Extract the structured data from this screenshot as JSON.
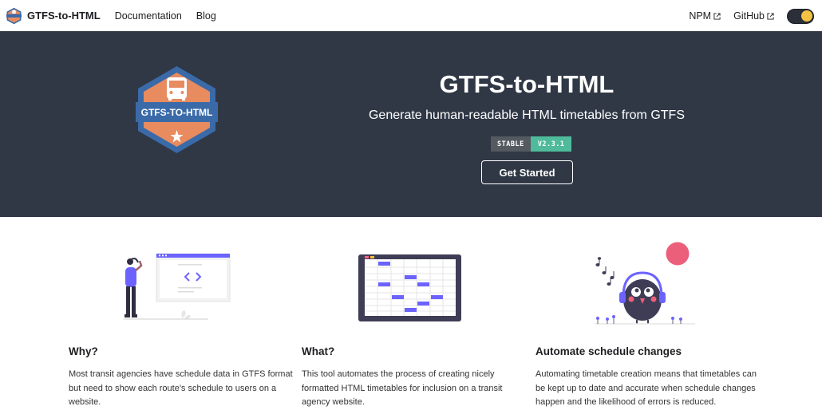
{
  "navbar": {
    "brand_title": "GTFS-to-HTML",
    "links": [
      "Documentation",
      "Blog"
    ],
    "right_links": [
      "NPM",
      "GitHub"
    ]
  },
  "hero": {
    "title": "GTFS-to-HTML",
    "subtitle": "Generate human-readable HTML timetables from GTFS",
    "badge": {
      "label": "STABLE",
      "version": "V2.3.1"
    },
    "cta_label": "Get Started",
    "logo_text": "GTFS-TO-HTML"
  },
  "features": [
    {
      "title": "Why?",
      "text": "Most transit agencies have schedule data in GTFS format but need to show each route's schedule to users on a website."
    },
    {
      "title": "What?",
      "text": "This tool automates the process of creating nicely formatted HTML timetables for inclusion on a transit agency website."
    },
    {
      "title": "Automate schedule changes",
      "text": "Automating timetable creation means that timetables can be kept up to date and accurate when schedule changes happen and the likelihood of errors is reduced."
    }
  ],
  "colors": {
    "hero_bg": "#303846",
    "badge_accent": "#4fbb9b",
    "logo_orange": "#e88b5f",
    "logo_blue": "#3a6aa8",
    "illustration_purple": "#6c63ff",
    "circle_pink": "#ec5f7b"
  },
  "icons": [
    "bus-logo-icon",
    "external-link-icon",
    "theme-toggle-icon",
    "code-window-illustration",
    "timetable-tablet-illustration",
    "music-bird-illustration"
  ]
}
